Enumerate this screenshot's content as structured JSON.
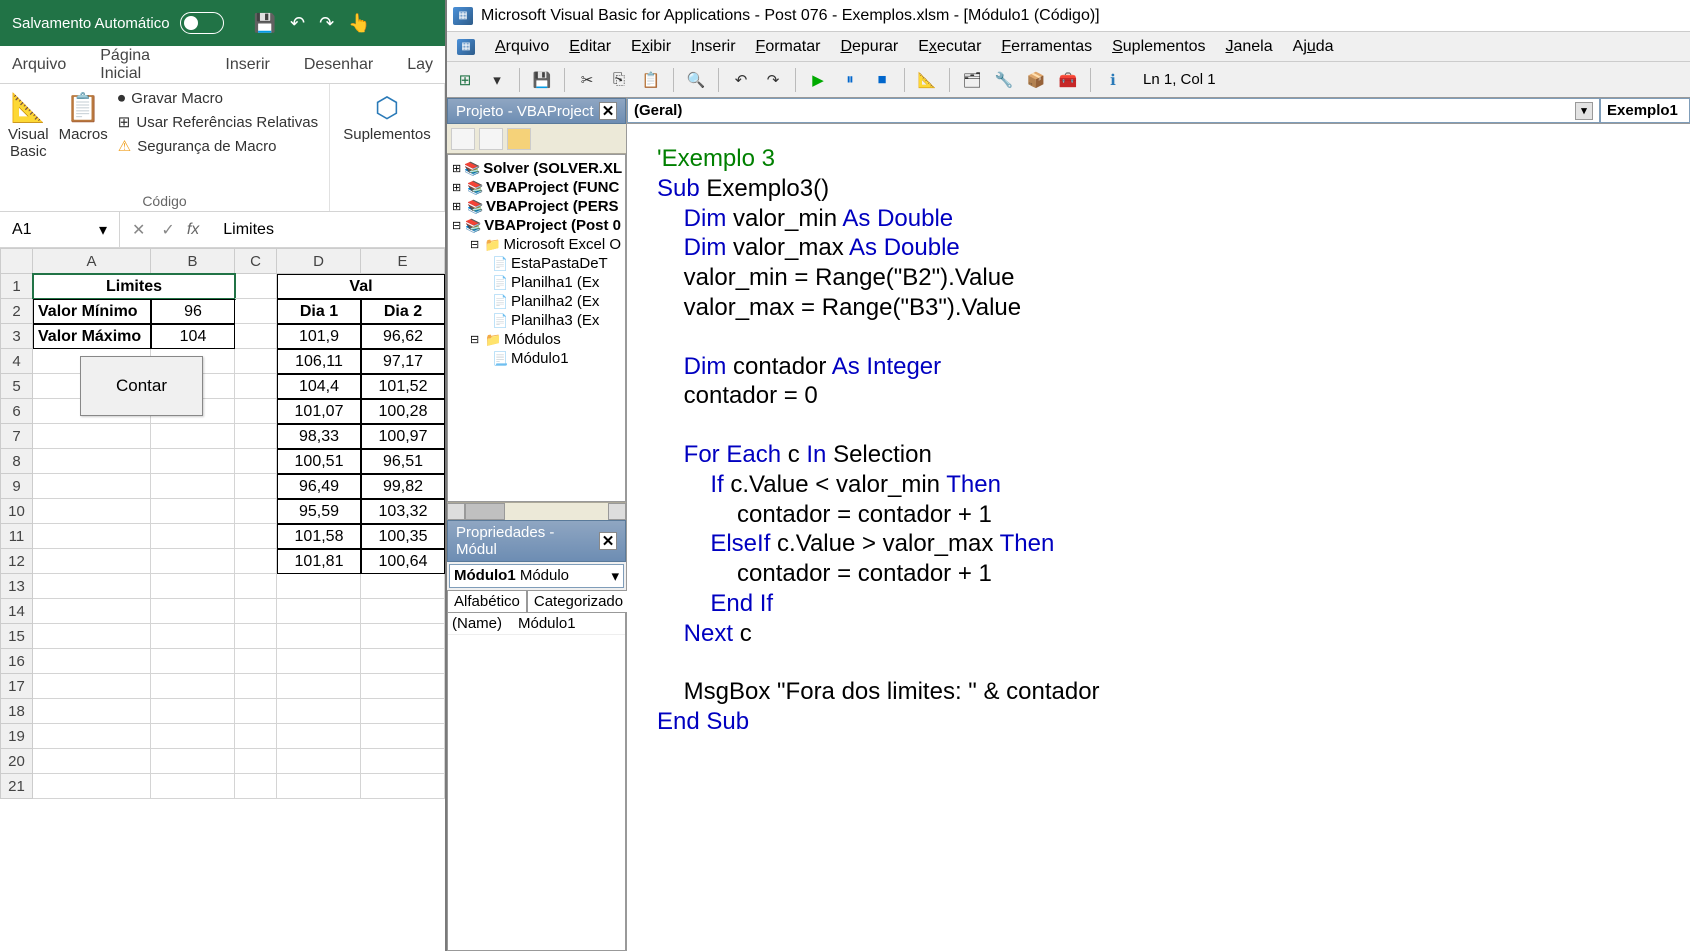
{
  "excel": {
    "autosave_label": "Salvamento Automático",
    "tabs": {
      "arquivo": "Arquivo",
      "inicio": "Página Inicial",
      "inserir": "Inserir",
      "desenhar": "Desenhar",
      "layout": "Lay"
    },
    "ribbon": {
      "visual_basic": "Visual\nBasic",
      "macros": "Macros",
      "gravar": "Gravar Macro",
      "usar_ref": "Usar Referências Relativas",
      "seguranca": "Segurança de Macro",
      "codigo_group": "Código",
      "suplementos": "Suplementos"
    },
    "namebox": "A1",
    "formula_value": "Limites",
    "columns": [
      "A",
      "B",
      "C",
      "D",
      "E"
    ],
    "row_headers": [
      "1",
      "2",
      "3",
      "4",
      "5",
      "6",
      "7",
      "8",
      "9",
      "10",
      "11",
      "12",
      "13",
      "14",
      "15",
      "16",
      "17",
      "18",
      "19",
      "20",
      "21"
    ],
    "data": {
      "A1": "Limites",
      "B1": "",
      "A2": "Valor Mínimo",
      "B2": "96",
      "A3": "Valor Máximo",
      "B3": "104",
      "D1": "Dia 1",
      "E1": "Dia 2",
      "E0": "Val",
      "D2": "101,9",
      "E2": "96,62",
      "D3": "106,11",
      "E3": "97,17",
      "D4": "104,4",
      "E4": "101,52",
      "D5": "101,07",
      "E5": "100,28",
      "D6": "98,33",
      "E6": "100,97",
      "D7": "100,51",
      "E7": "96,51",
      "D8": "96,49",
      "E8": "99,82",
      "D9": "95,59",
      "E9": "103,32",
      "D10": "101,58",
      "E10": "100,35",
      "D11": "101,81",
      "E11": "100,64"
    },
    "contar_btn": "Contar"
  },
  "vba": {
    "title": "Microsoft Visual Basic for Applications - Post 076 - Exemplos.xlsm - [Módulo1 (Código)]",
    "menu": {
      "arquivo": "Arquivo",
      "editar": "Editar",
      "exibir": "Exibir",
      "inserir": "Inserir",
      "formatar": "Formatar",
      "depurar": "Depurar",
      "executar": "Executar",
      "ferramentas": "Ferramentas",
      "suplementos": "Suplementos",
      "janela": "Janela",
      "ajuda": "Ajuda"
    },
    "cursor": "Ln 1, Col 1",
    "project_title": "Projeto - VBAProject",
    "tree": {
      "solver": "Solver (SOLVER.XL",
      "func": "VBAProject (FUNC",
      "pers": "VBAProject (PERS",
      "post": "VBAProject (Post 0",
      "excel_obj": "Microsoft Excel O",
      "esta": "EstaPastaDeT",
      "plan1": "Planilha1 (Ex",
      "plan2": "Planilha2 (Ex",
      "plan3": "Planilha3 (Ex",
      "modulos": "Módulos",
      "modulo1": "Módulo1"
    },
    "props_title": "Propriedades - Módul",
    "props_combo_name": "Módulo1",
    "props_combo_type": "Módulo",
    "props_tabs": {
      "alpha": "Alfabético",
      "cat": "Categorizado"
    },
    "props_name_key": "(Name)",
    "props_name_val": "Módulo1",
    "combo_general": "(Geral)",
    "combo_proc": "Exemplo1",
    "code": {
      "l1": "'Exemplo 3",
      "l2a": "Sub",
      "l2b": " Exemplo3()",
      "l3a": "    Dim",
      "l3b": " valor_min ",
      "l3c": "As Double",
      "l4a": "    Dim",
      "l4b": " valor_max ",
      "l4c": "As Double",
      "l5": "    valor_min = Range(\"B2\").Value",
      "l6": "    valor_max = Range(\"B3\").Value",
      "l8a": "    Dim",
      "l8b": " contador ",
      "l8c": "As Integer",
      "l9": "    contador = 0",
      "l11a": "    For Each",
      "l11b": " c ",
      "l11c": "In",
      "l11d": " Selection",
      "l12a": "        If",
      "l12b": " c.Value < valor_min ",
      "l12c": "Then",
      "l13": "            contador = contador + 1",
      "l14a": "        ElseIf",
      "l14b": " c.Value > valor_max ",
      "l14c": "Then",
      "l15": "            contador = contador + 1",
      "l16": "        End If",
      "l17a": "    Next",
      "l17b": " c",
      "l19": "    MsgBox \"Fora dos limites: \" & contador",
      "l20": "End Sub"
    }
  }
}
